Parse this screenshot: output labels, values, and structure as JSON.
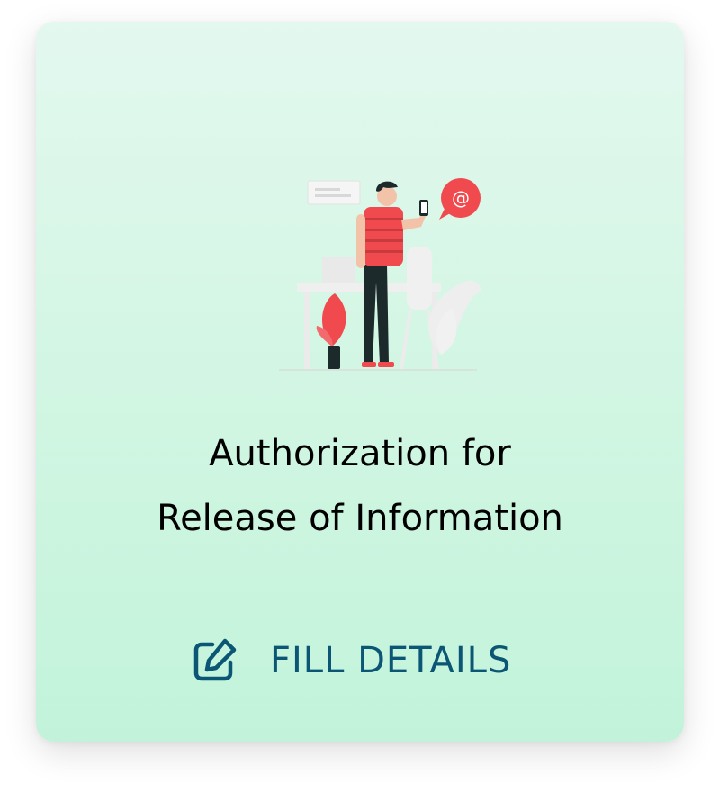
{
  "card": {
    "title_line1": "Authorization for",
    "title_line2": "Release of Information",
    "illustration_icon": "person-with-phone-illustration",
    "action": {
      "label": "FILL DETAILS",
      "icon": "edit-icon",
      "color": "#0b5575"
    },
    "colors": {
      "accent_red": "#f04a4f",
      "background_top": "#e3f8ef",
      "background_bottom": "#c2f3da"
    }
  }
}
